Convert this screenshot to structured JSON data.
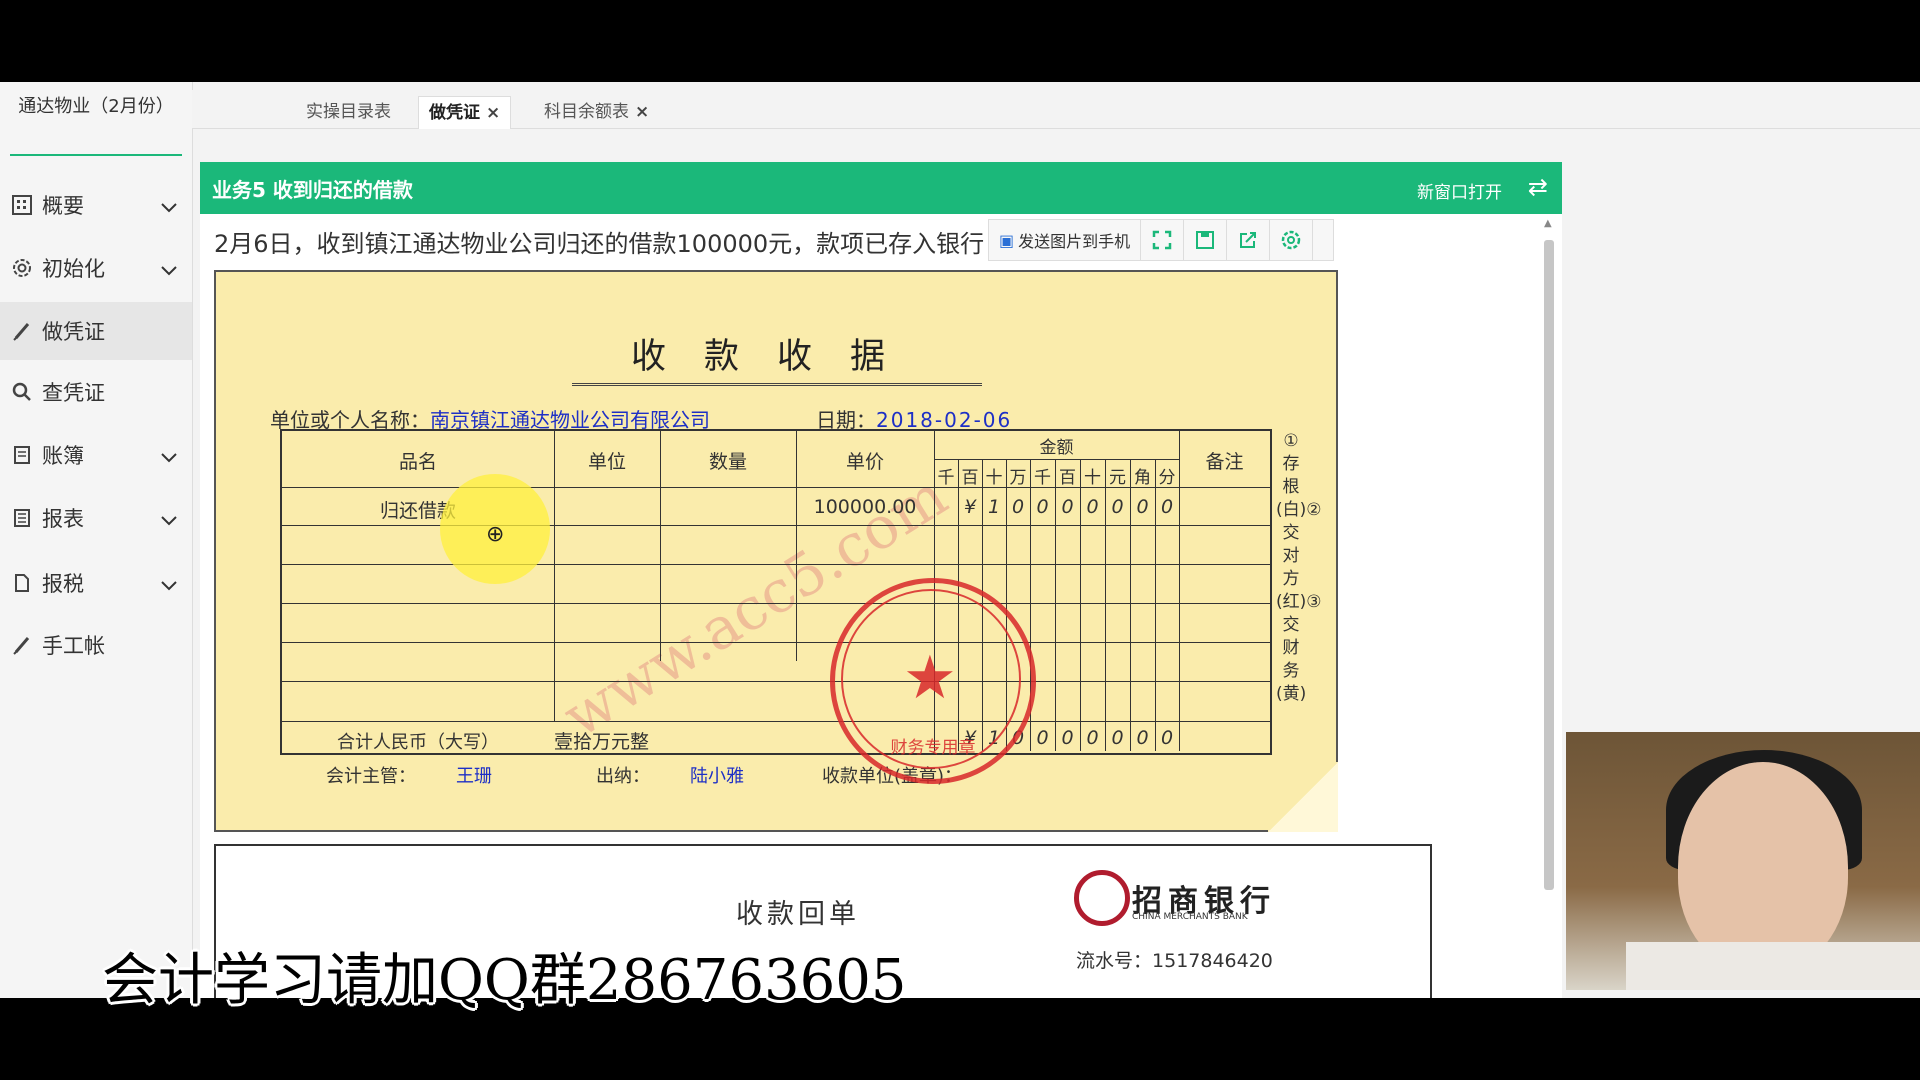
{
  "sidebar": {
    "company": "通达物业（2月份）",
    "items": [
      {
        "label": "概要",
        "icon": "grid-icon",
        "has_chevron": true
      },
      {
        "label": "初始化",
        "icon": "gear-icon",
        "has_chevron": true
      },
      {
        "label": "做凭证",
        "icon": "pen-icon",
        "has_chevron": false
      },
      {
        "label": "查凭证",
        "icon": "search-icon",
        "has_chevron": false
      },
      {
        "label": "账簿",
        "icon": "book-icon",
        "has_chevron": true
      },
      {
        "label": "报表",
        "icon": "report-icon",
        "has_chevron": true
      },
      {
        "label": "报税",
        "icon": "document-icon",
        "has_chevron": true
      },
      {
        "label": "手工帐",
        "icon": "pen-icon",
        "has_chevron": false
      }
    ]
  },
  "tabs": [
    {
      "label": "实操目录表",
      "closable": false
    },
    {
      "label": "做凭证",
      "closable": true,
      "active": true
    },
    {
      "label": "科目余额表",
      "closable": true
    }
  ],
  "task": {
    "title": "业务5 收到归还的借款",
    "new_window": "新窗口打开",
    "description": "2月6日，收到镇江通达物业公司归还的借款100000元，款项已存入银行"
  },
  "toolbar": {
    "send_label": "发送图片到手机"
  },
  "receipt": {
    "title": "收款收据",
    "payer_label": "单位或个人名称：",
    "payer_value": "南京镇江通达物业公司有限公司",
    "date_label": "日期：",
    "date_value": "2018-02-06",
    "headers": {
      "item": "品名",
      "unit": "单位",
      "qty": "数量",
      "price": "单价",
      "amount": "金额",
      "note": "备注"
    },
    "digit_headers": [
      "千",
      "百",
      "十",
      "万",
      "千",
      "百",
      "十",
      "元",
      "角",
      "分"
    ],
    "row1": {
      "item": "归还借款",
      "price": "100000.00",
      "digits": [
        "",
        "¥",
        "1",
        "0",
        "0",
        "0",
        "0",
        "0",
        "0",
        "0"
      ]
    },
    "total_label": "合计人民币（大写）",
    "total_value": "壹拾万元整",
    "total_digits": [
      "",
      "¥",
      "1",
      "0",
      "0",
      "0",
      "0",
      "0",
      "0",
      "0"
    ],
    "accountant_label": "会计主管：",
    "accountant_value": "王珊",
    "cashier_label": "出纳：",
    "cashier_value": "陆小雅",
    "receiver_label": "收款单位(盖章)：",
    "side_notes": "①存根(白)②交对方(红)③交财务(黄)",
    "seal_text": "财务专用章",
    "watermark": "www.acc5.com"
  },
  "bank_receipt": {
    "title": "收款回单",
    "bank_name": "招商银行",
    "bank_en": "CHINA MERCHANTS BANK",
    "serial_label": "流水号：",
    "serial_value": "1517846420"
  },
  "caption": "会计学习请加QQ群286763605",
  "colors": {
    "accent": "#1bb87a",
    "paper": "#faecac",
    "ink_blue": "#1d2fc6",
    "seal_red": "#d8282a"
  }
}
